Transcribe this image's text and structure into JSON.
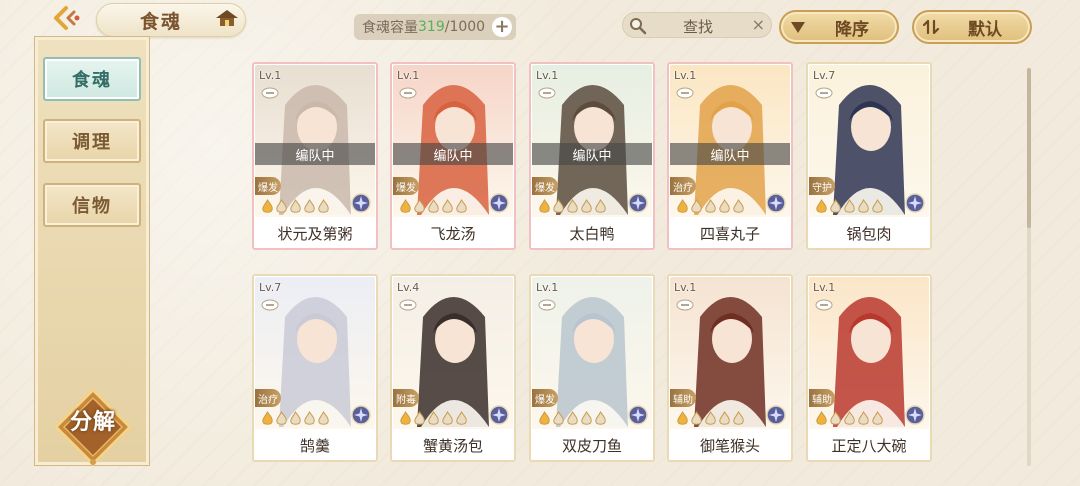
{
  "header": {
    "title": "食魂",
    "capacity_label": "食魂容量",
    "capacity_current": "319",
    "capacity_max": "/1000",
    "capacity_add": "+",
    "search_label": "查找",
    "search_clear": "×",
    "sort_order_label": "降序",
    "sort_mode_label": "默认"
  },
  "sidebar": {
    "tabs": [
      {
        "label": "食魂",
        "active": true
      },
      {
        "label": "调理",
        "active": false
      },
      {
        "label": "信物",
        "active": false
      }
    ],
    "decompose_label": "分解"
  },
  "cards": [
    {
      "name": "状元及第粥",
      "level": "Lv.1",
      "status": "编队中",
      "role": "爆发",
      "element_color": "#5a5f9a",
      "tint": [
        "#e8ded2",
        "#c9b9ab"
      ]
    },
    {
      "name": "飞龙汤",
      "level": "Lv.1",
      "status": "编队中",
      "role": "爆发",
      "element_color": "#5a5f9a",
      "tint": [
        "#f6d5c8",
        "#d8613f"
      ]
    },
    {
      "name": "太白鸭",
      "level": "Lv.1",
      "status": "编队中",
      "role": "爆发",
      "element_color": "#5a5f9a",
      "tint": [
        "#e6efe2",
        "#5b4c3e"
      ]
    },
    {
      "name": "四喜丸子",
      "level": "Lv.1",
      "status": "编队中",
      "role": "治疗",
      "element_color": "#5a5f9a",
      "tint": [
        "#fbe6c2",
        "#e2a24a"
      ]
    },
    {
      "name": "锅包肉",
      "level": "Lv.7",
      "status": "",
      "role": "守护",
      "element_color": "#5a5f9a",
      "tint": [
        "#fbf2dc",
        "#2e3553"
      ]
    },
    {
      "name": "鹄羹",
      "level": "Lv.7",
      "status": "",
      "role": "治疗",
      "element_color": "#5a5f9a",
      "tint": [
        "#eceef5",
        "#c9cad6"
      ]
    },
    {
      "name": "蟹黄汤包",
      "level": "Lv.4",
      "status": "",
      "role": "附毒",
      "element_color": "#5a5f9a",
      "tint": [
        "#f4efe6",
        "#3a2e2a"
      ]
    },
    {
      "name": "双皮刀鱼",
      "level": "Lv.1",
      "status": "",
      "role": "爆发",
      "element_color": "#5a5f9a",
      "tint": [
        "#eef2ea",
        "#b8c4cf"
      ]
    },
    {
      "name": "御笔猴头",
      "level": "Lv.1",
      "status": "",
      "role": "辅助",
      "element_color": "#5a5f9a",
      "tint": [
        "#f5e3d2",
        "#6e2e22"
      ]
    },
    {
      "name": "正定八大碗",
      "level": "Lv.1",
      "status": "",
      "role": "辅助",
      "element_color": "#5a5f9a",
      "tint": [
        "#fbe6c8",
        "#b8382e"
      ]
    }
  ],
  "colors": {
    "accent_gold": "#c99f55",
    "capacity_green": "#58b05a",
    "active_tab": "#8fc0b3"
  }
}
